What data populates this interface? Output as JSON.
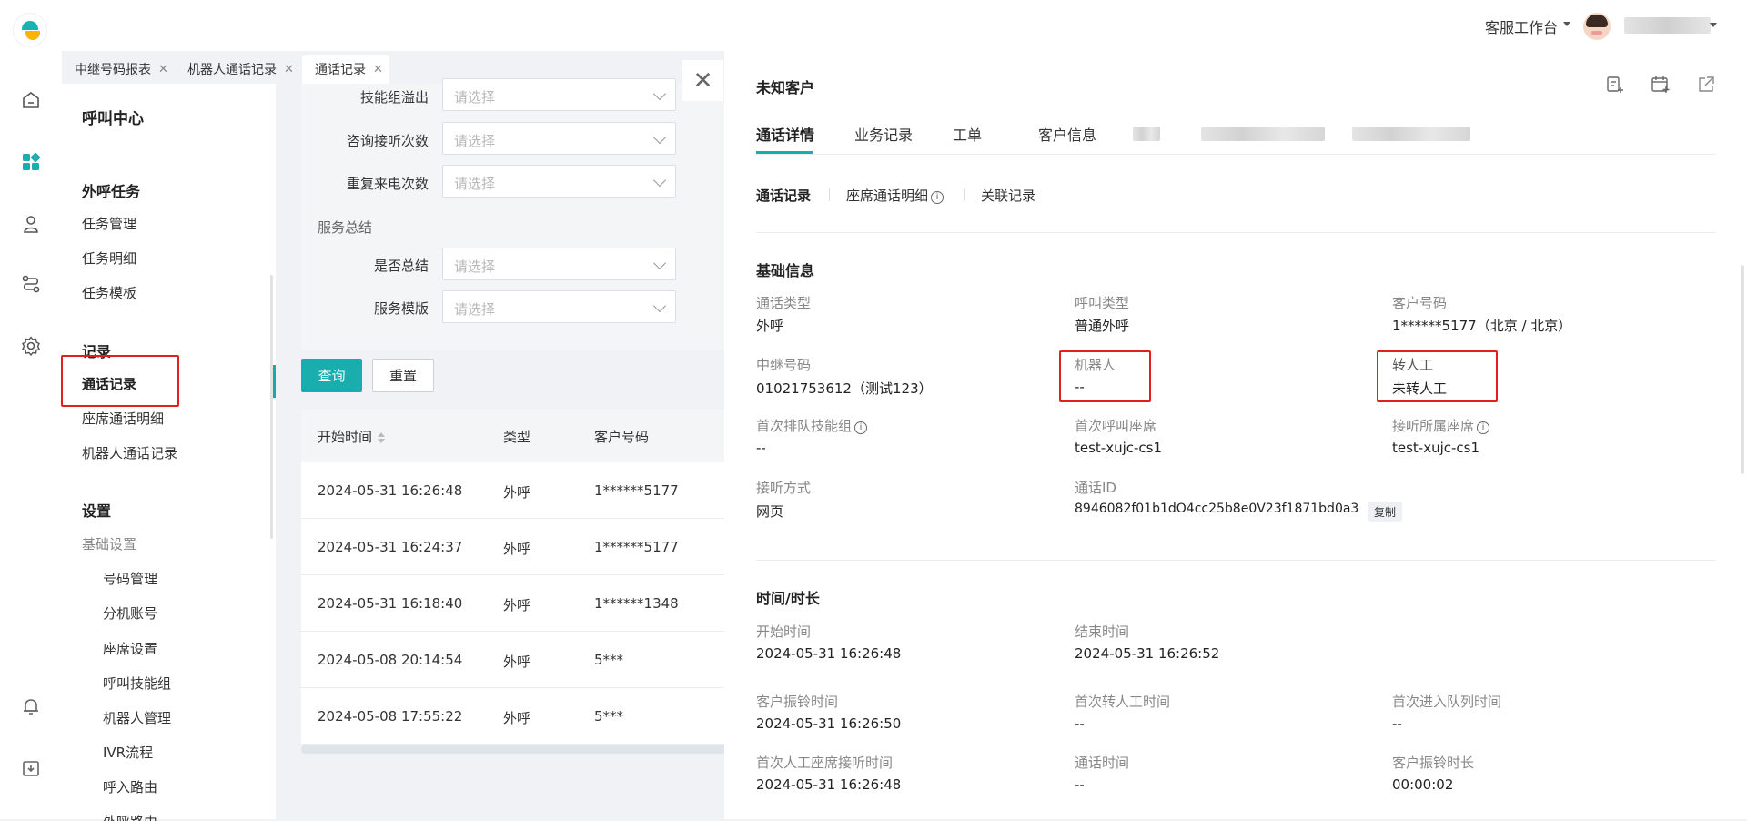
{
  "header": {
    "workspace": "客服工作台"
  },
  "menu": {
    "title": "呼叫中心",
    "groups": {
      "outbound": {
        "label": "外呼任务",
        "items": [
          "任务管理",
          "任务明细",
          "任务模板"
        ]
      },
      "records": {
        "label": "记录",
        "items": [
          "通话记录",
          "座席通话明细",
          "机器人通话记录"
        ]
      },
      "settings": {
        "label": "设置",
        "sub": "基础设置",
        "items": [
          "号码管理",
          "分机账号",
          "座席设置",
          "呼叫技能组",
          "机器人管理",
          "IVR流程",
          "呼入路由",
          "外呼路由"
        ]
      }
    }
  },
  "tabs": [
    {
      "label": "中继号码报表"
    },
    {
      "label": "机器人通话记录"
    },
    {
      "label": "通话记录"
    }
  ],
  "filter": {
    "placeholder": "请选择",
    "fields": [
      "技能组溢出",
      "咨询接听次数",
      "重复来电次数"
    ],
    "section": "服务总结",
    "summary_fields": [
      "是否总结",
      "服务模版"
    ],
    "search_btn": "查询",
    "reset_btn": "重置"
  },
  "table": {
    "headers": [
      "开始时间",
      "类型",
      "客户号码"
    ],
    "rows": [
      [
        "2024-05-31 16:26:48",
        "外呼",
        "1******5177"
      ],
      [
        "2024-05-31 16:24:37",
        "外呼",
        "1******5177"
      ],
      [
        "2024-05-31 16:18:40",
        "外呼",
        "1******1348"
      ],
      [
        "2024-05-08 20:14:54",
        "外呼",
        "5***"
      ],
      [
        "2024-05-08 17:55:22",
        "外呼",
        "5***"
      ]
    ]
  },
  "drawer": {
    "title": "未知客户",
    "close": "✕",
    "tabs": [
      "通话详情",
      "业务记录",
      "工单",
      "客户信息"
    ],
    "sub_tabs": [
      "通话记录",
      "座席通话明细",
      "关联记录"
    ],
    "basic": {
      "title": "基础信息",
      "fields": [
        {
          "k": "通话类型",
          "v": "外呼"
        },
        {
          "k": "呼叫类型",
          "v": "普通外呼"
        },
        {
          "k": "客户号码",
          "v": "1******5177（北京 / 北京）"
        },
        {
          "k": "中继号码",
          "v": "01021753612（测试123）"
        },
        {
          "k": "机器人",
          "v": "--"
        },
        {
          "k": "转人工",
          "v": "未转人工"
        },
        {
          "k": "首次排队技能组",
          "v": "--"
        },
        {
          "k": "首次呼叫座席",
          "v": "test-xujc-cs1"
        },
        {
          "k": "接听所属座席",
          "v": "test-xujc-cs1"
        },
        {
          "k": "接听方式",
          "v": "网页"
        },
        {
          "k": "通话ID",
          "v": "8946082f01b1dO4cc25b8e0V23f1871bd0a3"
        }
      ],
      "copy": "复制"
    },
    "time": {
      "title": "时间/时长",
      "fields": [
        {
          "k": "开始时间",
          "v": "2024-05-31 16:26:48"
        },
        {
          "k": "结束时间",
          "v": "2024-05-31 16:26:52"
        },
        {
          "k": "客户振铃时间",
          "v": "2024-05-31 16:26:50"
        },
        {
          "k": "首次转人工时间",
          "v": "--"
        },
        {
          "k": "首次进入队列时间",
          "v": "--"
        },
        {
          "k": "首次人工座席接听时间",
          "v": "2024-05-31 16:26:48"
        },
        {
          "k": "通话时间",
          "v": "--"
        },
        {
          "k": "客户振铃时长",
          "v": "00:00:02"
        }
      ]
    }
  },
  "colors": {
    "accent": "#1aadad",
    "highlight_box": "#e02020"
  }
}
